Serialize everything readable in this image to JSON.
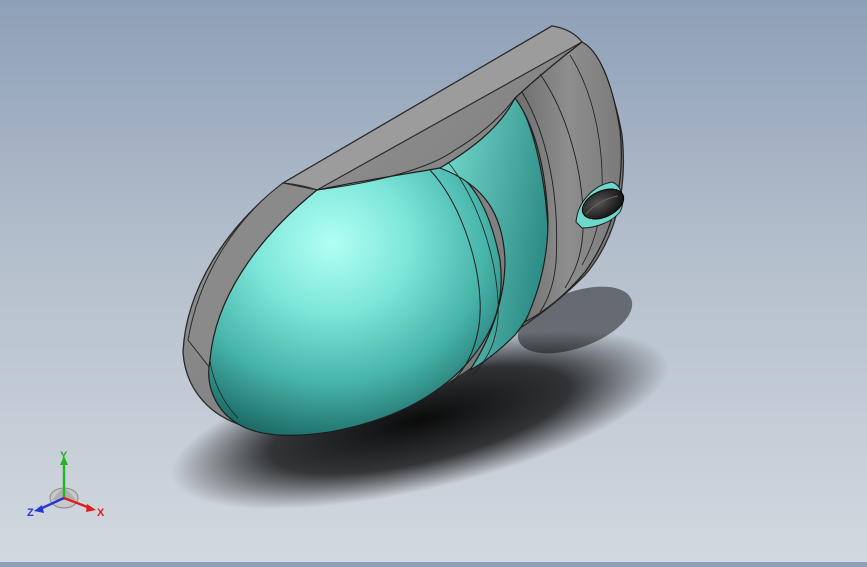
{
  "colors": {
    "background_top": "#8ea0b7",
    "background_bottom": "#d2d8df",
    "body_light": "#a6fff1",
    "body_mid": "#58c8bc",
    "body_dark": "#1c6a66",
    "shell_gray": "#808080",
    "edge_dark": "#2a2a2a",
    "x_axis": "#e21b1b",
    "y_axis": "#21b521",
    "z_axis": "#2a35d6"
  },
  "icons": {
    "triad": "reference-triad-icon",
    "scroll_wheel": "scroll-wheel-icon"
  },
  "triad": {
    "x_label": "X",
    "y_label": "Y",
    "z_label": "Z"
  }
}
